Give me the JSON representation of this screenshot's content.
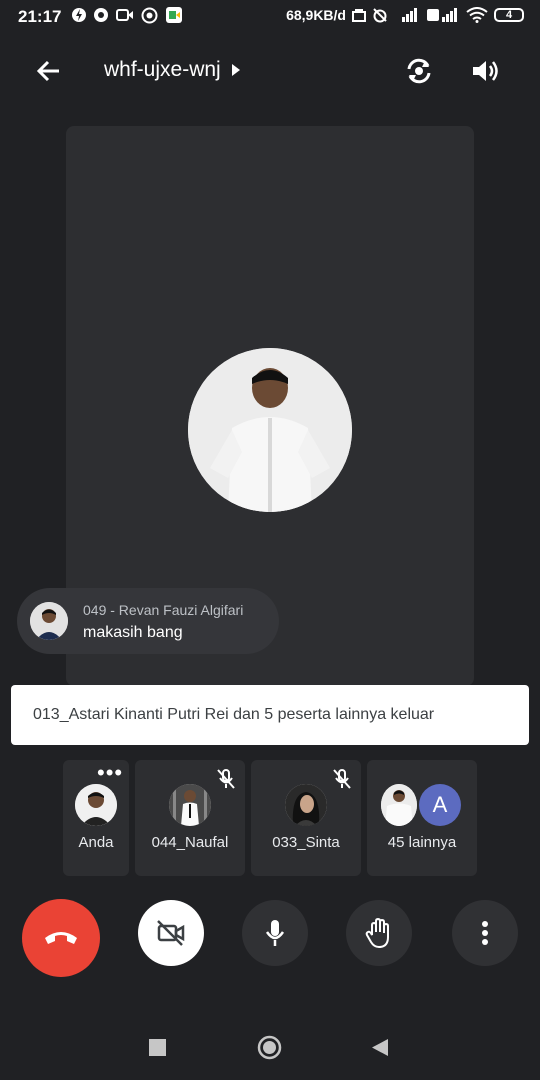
{
  "status_bar": {
    "time": "21:17",
    "net_speed": "68,9KB/d",
    "battery": "4"
  },
  "header": {
    "meeting_code": "whf-ujxe-wnj"
  },
  "icons": {
    "back": "arrow-left-icon",
    "switch_camera": "switch-camera-icon",
    "audio": "speaker-icon"
  },
  "chat": {
    "sender": "049 - Revan Fauzi Algifari",
    "message": "makasih bang"
  },
  "toast": {
    "text": "013_Astari Kinanti Putri Rei dan 5 peserta lainnya keluar"
  },
  "participants": [
    {
      "name": "Anda",
      "muted": false
    },
    {
      "name": "044_Naufal",
      "muted": true
    },
    {
      "name": "033_Sinta",
      "muted": true
    },
    {
      "name": "45 lainnya",
      "avatar_letter": "A"
    }
  ],
  "colors": {
    "end_call": "#ea4335",
    "background": "#202124",
    "tile": "#2d2e31",
    "avatar_letter_bg": "#5c6bc0"
  }
}
